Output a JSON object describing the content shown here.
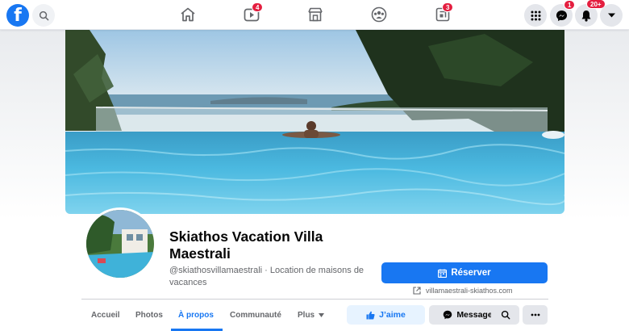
{
  "topnav": {
    "logo": "f",
    "badges": {
      "watch": "4",
      "pages": "3",
      "messenger": "1",
      "notifications": "20+"
    },
    "icons": [
      "facebook-logo",
      "search-icon",
      "home-icon",
      "watch-icon",
      "marketplace-icon",
      "groups-icon",
      "pages-icon",
      "menu-grid-icon",
      "messenger-icon",
      "bell-icon",
      "caret-down-icon"
    ]
  },
  "page": {
    "name": "Skiathos Vacation Villa Maestrali",
    "handle_category": "@skiathosvillamaestrali · Location de maisons de vacances",
    "cta_label": "Réserver",
    "website": "villamaestrali-skiathos.com"
  },
  "tabs": [
    {
      "label": "Accueil",
      "active": false
    },
    {
      "label": "Photos",
      "active": false
    },
    {
      "label": "À propos",
      "active": true
    },
    {
      "label": "Communauté",
      "active": false
    },
    {
      "label": "Plus",
      "active": false
    }
  ],
  "actions": {
    "like": "J’aime",
    "message": "Message"
  },
  "colors": {
    "brand": "#1877f2",
    "badge": "#e41e3f",
    "secondary_bg": "#e4e6eb"
  }
}
